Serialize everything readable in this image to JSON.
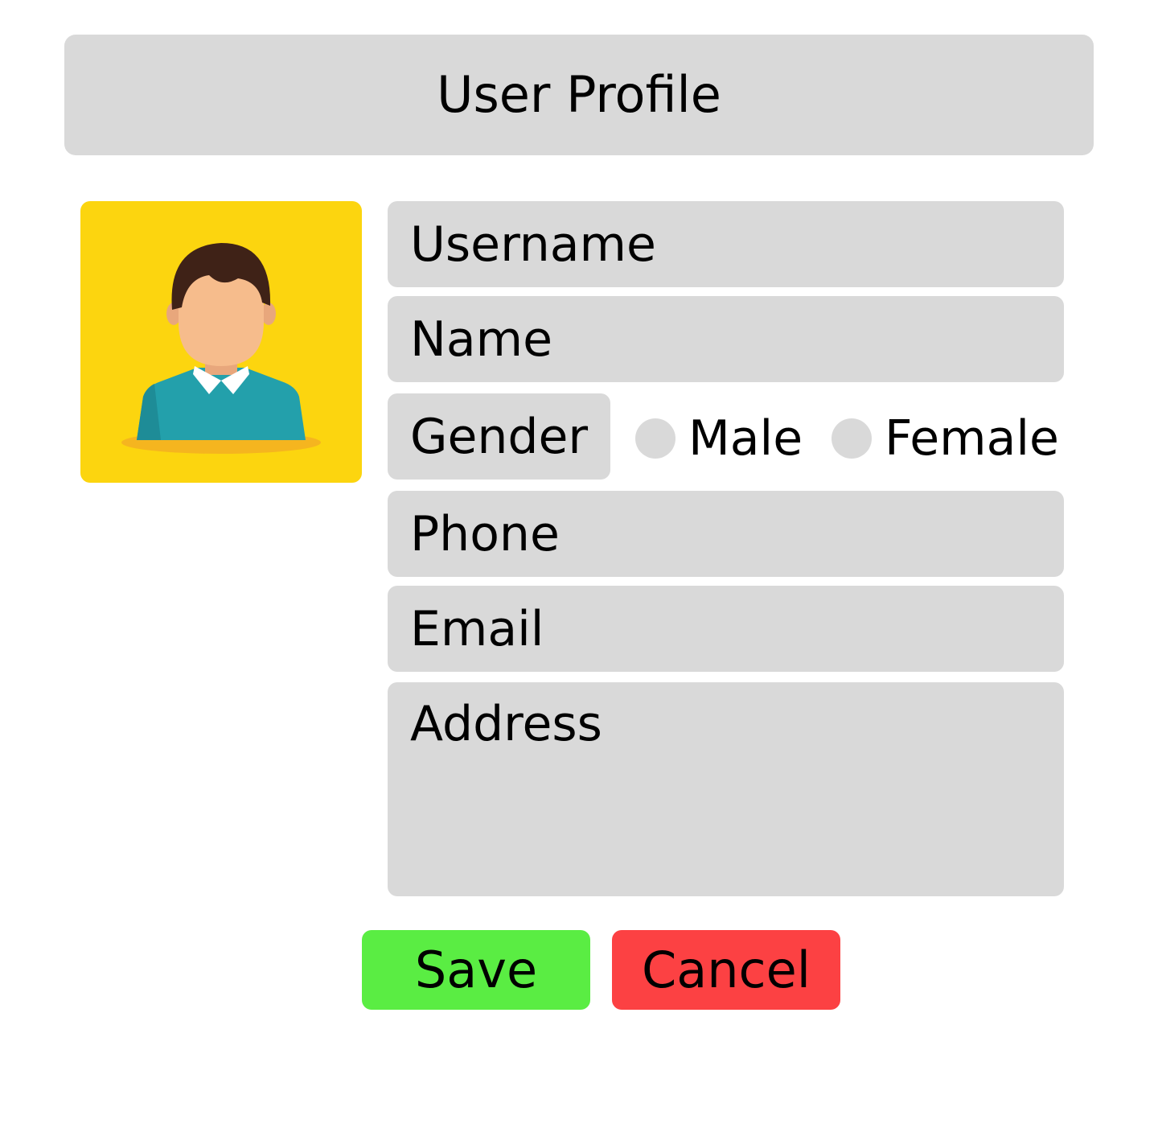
{
  "header": {
    "title": "User Profile"
  },
  "avatar": {
    "icon": "user-avatar-icon",
    "background": "#fcd50f"
  },
  "form": {
    "username": {
      "placeholder": "Username"
    },
    "name": {
      "placeholder": "Name"
    },
    "gender": {
      "label": "Gender",
      "options": [
        "Male",
        "Female"
      ]
    },
    "phone": {
      "placeholder": "Phone"
    },
    "email": {
      "placeholder": "Email"
    },
    "address": {
      "placeholder": "Address"
    }
  },
  "actions": {
    "save_label": "Save",
    "cancel_label": "Cancel"
  },
  "colors": {
    "field_bg": "#d9d9d9",
    "save": "#5aed43",
    "cancel": "#fc4143"
  }
}
